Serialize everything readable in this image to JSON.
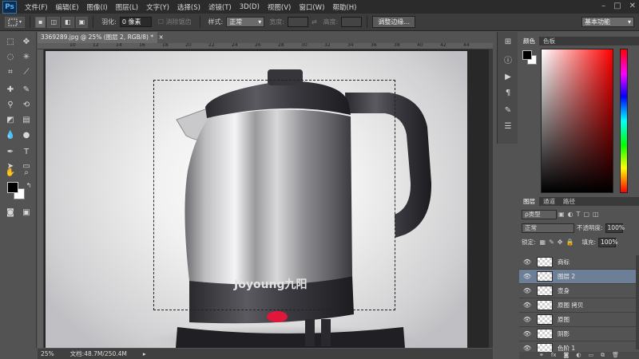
{
  "app": {
    "logo": "Ps",
    "menu": [
      "文件(F)",
      "编辑(E)",
      "图像(I)",
      "图层(L)",
      "文字(Y)",
      "选择(S)",
      "滤镜(T)",
      "3D(D)",
      "视图(V)",
      "窗口(W)",
      "帮助(H)"
    ],
    "window_controls": [
      "–",
      "□",
      "✕"
    ]
  },
  "options": {
    "feather_label": "羽化:",
    "feather_value": "0 像素",
    "antialias_label": "消除锯齿",
    "style_label": "样式:",
    "style_value": "正常",
    "width_label": "宽度:",
    "height_label": "高度:",
    "refine_edge": "调整边缘...",
    "workspace": "基本功能"
  },
  "document": {
    "tab_title": "3369289.jpg @ 25% (图层 2, RGB/8) *",
    "ruler_numbers": [
      "10",
      "12",
      "14",
      "16",
      "18",
      "20",
      "22",
      "24",
      "26",
      "28",
      "30",
      "32",
      "34",
      "36",
      "38",
      "40",
      "42",
      "44"
    ],
    "product_brand": "Joyoung九阳"
  },
  "status": {
    "zoom": "25%",
    "doc_size": "文档:48.7M/250.4M"
  },
  "color_panel": {
    "tabs": [
      "颜色",
      "色板"
    ]
  },
  "layers_panel": {
    "tabs": [
      "图层",
      "通道",
      "路径"
    ],
    "filter_kind": "ρ类型",
    "blend_mode": "正常",
    "opacity_label": "不透明度:",
    "opacity_value": "100%",
    "lock_label": "锁定:",
    "fill_label": "填充:",
    "fill_value": "100%",
    "layers": [
      {
        "name": "商标",
        "selected": false
      },
      {
        "name": "图层 2",
        "selected": true
      },
      {
        "name": "壶身",
        "selected": false
      },
      {
        "name": "原图 拷贝",
        "selected": false
      },
      {
        "name": "原图",
        "selected": false
      },
      {
        "name": "阴影",
        "selected": false
      },
      {
        "name": "色阶 1",
        "selected": false
      }
    ],
    "footer_icons": [
      "link-icon",
      "fx-icon",
      "mask-icon",
      "adjustment-icon",
      "folder-icon",
      "new-layer-icon",
      "trash-icon"
    ]
  },
  "colors": {
    "selection_highlight": "#6d7f96",
    "foreground": "#000000",
    "background": "#ffffff"
  }
}
